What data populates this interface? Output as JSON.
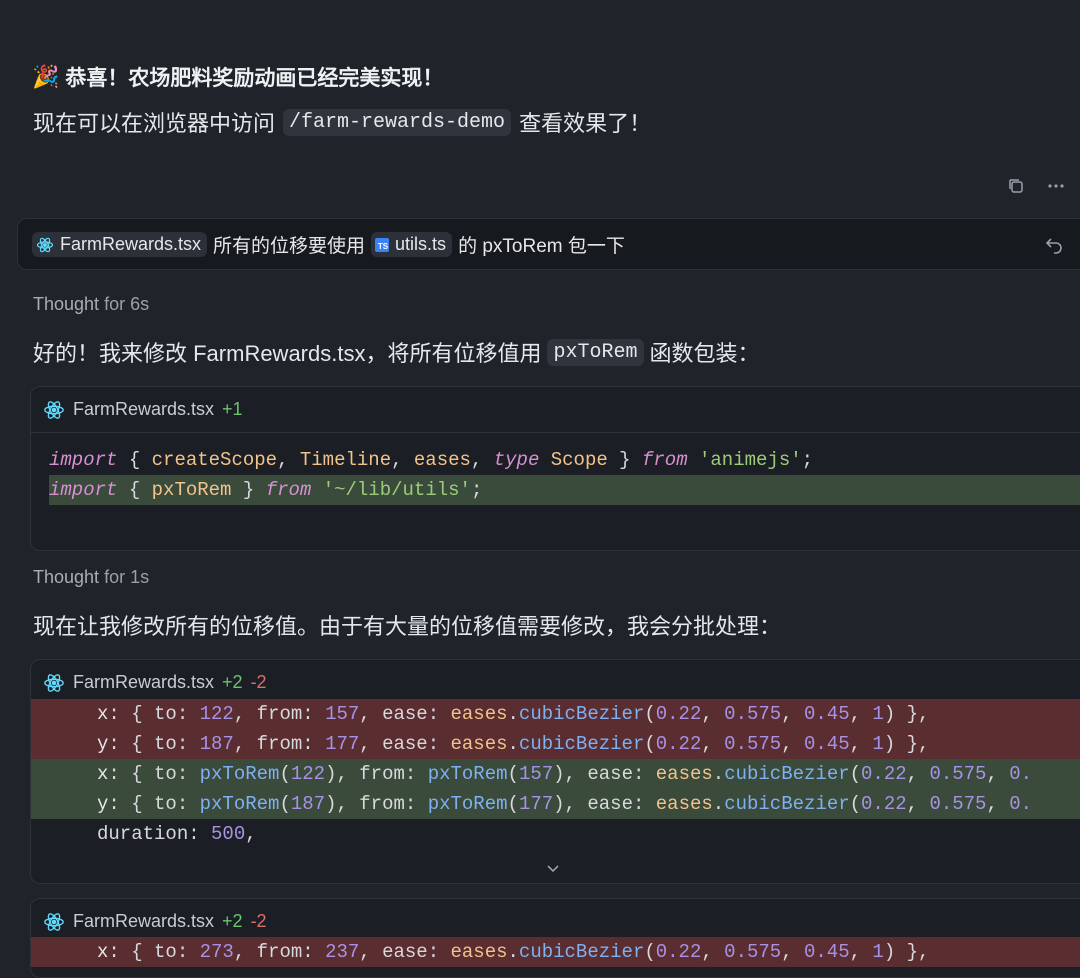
{
  "header": {
    "emoji": "🎉",
    "title": "恭喜！农场肥料奖励动画已经完美实现！",
    "sub_before": "现在可以在浏览器中访问",
    "sub_code": "/farm-rewards-demo",
    "sub_after": "查看效果了！"
  },
  "user_message": {
    "file1": "FarmRewards.tsx",
    "text1": "所有的位移要使用",
    "file2": "utils.ts",
    "file2_badge": "TS",
    "text2": "的 pxToRem 包一下"
  },
  "thought1": {
    "label": "Thought",
    "duration": "for 6s"
  },
  "reply1": {
    "before": "好的！我来修改 FarmRewards.tsx，将所有位移值用",
    "code": "pxToRem",
    "after": "函数包装："
  },
  "card1": {
    "file": "FarmRewards.tsx",
    "added": "+1",
    "lines": [
      "import { createScope, Timeline, eases, type Scope } from 'animejs';",
      "import { pxToRem } from '~/lib/utils';"
    ]
  },
  "thought2": {
    "label": "Thought",
    "duration": "for 1s"
  },
  "reply2": {
    "text": "现在让我修改所有的位移值。由于有大量的位移值需要修改，我会分批处理："
  },
  "card2": {
    "file": "FarmRewards.tsx",
    "added": "+2",
    "removed": "-2",
    "lines": [
      "x: { to: 122, from: 157, ease: eases.cubicBezier(0.22, 0.575, 0.45, 1) },",
      "y: { to: 187, from: 177, ease: eases.cubicBezier(0.22, 0.575, 0.45, 1) },",
      "x: { to: pxToRem(122), from: pxToRem(157), ease: eases.cubicBezier(0.22, 0.575, 0.",
      "y: { to: pxToRem(187), from: pxToRem(177), ease: eases.cubicBezier(0.22, 0.575, 0.",
      "duration: 500,"
    ]
  },
  "card3": {
    "file": "FarmRewards.tsx",
    "added": "+2",
    "removed": "-2",
    "lines": [
      "x: { to: 273, from: 237, ease: eases.cubicBezier(0.22, 0.575, 0.45, 1) },"
    ]
  },
  "colors": {
    "background": "#1f232a",
    "added_line": "#3a4a3b",
    "removed_line": "#5a2d31",
    "plus": "#6cc46c",
    "minus": "#e06c6c"
  },
  "icons": [
    "party-emoji",
    "copy-icon",
    "more-icon",
    "ts-file-icon",
    "undo-icon",
    "react-icon",
    "chevron-down-icon"
  ]
}
